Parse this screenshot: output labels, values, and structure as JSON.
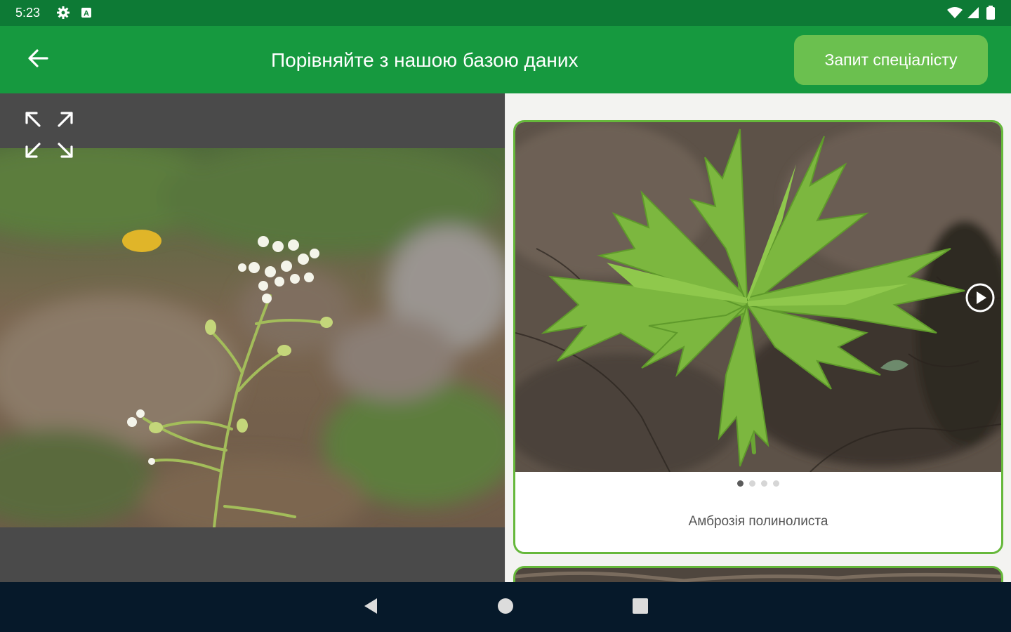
{
  "status_bar": {
    "time": "5:23",
    "icons": [
      "gear-icon",
      "text-a-icon",
      "wifi-icon",
      "signal-icon",
      "battery-icon"
    ]
  },
  "app_bar": {
    "back_icon": "arrow-left-icon",
    "title": "Порівняйте з нашою базою даних",
    "expert_button_label": "Запит спеціалісту",
    "background_color": "#16993f",
    "button_color": "#6bc04f"
  },
  "left_pane": {
    "expand_icon": "expand-arrows-icon",
    "photo": "user-plant-photo"
  },
  "match_list": {
    "items": [
      {
        "label": "Амброзія полинолиста",
        "photo": "ragweed-photo",
        "pager_count": 4,
        "pager_active": 1,
        "next_icon": "play-circle-icon"
      }
    ],
    "accent_color": "#66b83b"
  },
  "nav_bar": {
    "icons": [
      "back-triangle-icon",
      "home-circle-icon",
      "recents-square-icon"
    ]
  }
}
